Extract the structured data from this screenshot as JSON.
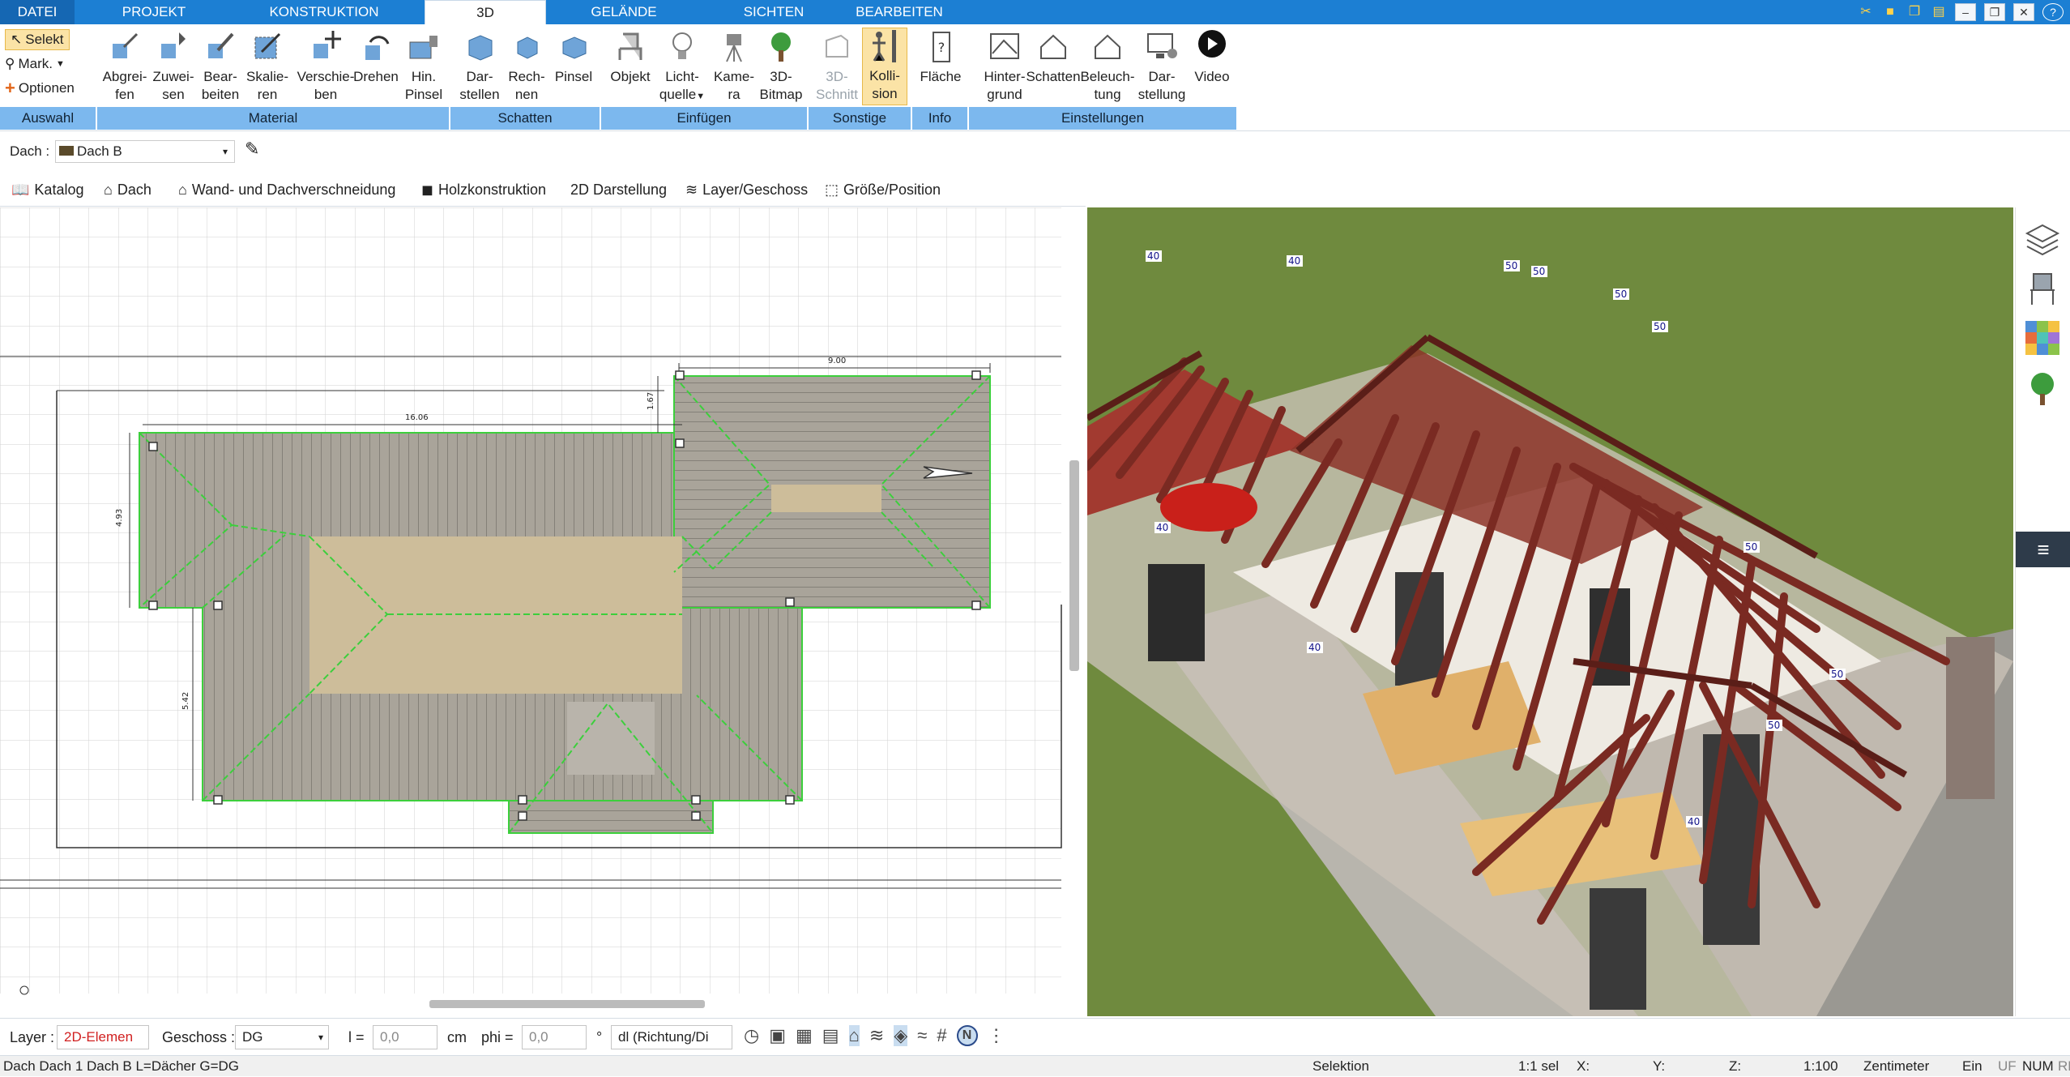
{
  "menu": {
    "tabs": [
      "DATEI",
      "PROJEKT",
      "KONSTRUKTION",
      "3D",
      "GELÄNDE",
      "SICHTEN",
      "BEARBEITEN"
    ],
    "active": "3D"
  },
  "ribbon": {
    "auswahl": {
      "selekt": "Selekt",
      "mark": "Mark.",
      "optionen": "Optionen"
    },
    "buttons": {
      "abgreifen": [
        "Abgrei-",
        "fen"
      ],
      "zuweisen": [
        "Zuwei-",
        "sen"
      ],
      "bearbeiten": [
        "Bear-",
        "beiten"
      ],
      "skalieren": [
        "Skalie-",
        "ren"
      ],
      "verschieben": [
        "Verschie-",
        "ben"
      ],
      "drehen": [
        "Drehen",
        ""
      ],
      "hinpinsel": [
        "Hin.",
        "Pinsel"
      ],
      "darstellen": [
        "Dar-",
        "stellen"
      ],
      "rechnen": [
        "Rech-",
        "nen"
      ],
      "pinsel": [
        "Pinsel",
        ""
      ],
      "objekt": [
        "Objekt",
        ""
      ],
      "lichtquelle": [
        "Licht-",
        "quelle"
      ],
      "kamera": [
        "Kame-",
        "ra"
      ],
      "bitmap": [
        "3D-",
        "Bitmap"
      ],
      "schnitt": [
        "3D-",
        "Schnitt"
      ],
      "kollision": [
        "Kolli-",
        "sion"
      ],
      "flaeche": [
        "Fläche",
        ""
      ],
      "hintergrund": [
        "Hinter-",
        "grund"
      ],
      "schatten": [
        "Schatten",
        ""
      ],
      "beleuchtung": [
        "Beleuch-",
        "tung"
      ],
      "darstellung": [
        "Dar-",
        "stellung"
      ],
      "video": [
        "Video",
        ""
      ]
    },
    "groups": [
      "Auswahl",
      "Material",
      "Schatten",
      "Einfügen",
      "Sonstige",
      "Info",
      "Einstellungen"
    ]
  },
  "dach": {
    "label": "Dach :",
    "value": "Dach B"
  },
  "toolbar2": [
    "Katalog",
    "Dach",
    "Wand- und Dachverschneidung",
    "Holzkonstruktion",
    "2D Darstellung",
    "Layer/Geschoss",
    "Größe/Position"
  ],
  "plan": {
    "dims": {
      "top_width": "9.00",
      "ridge_width": "16.06",
      "left_height": "4.93",
      "lower_height": "5.42",
      "small": "1.67"
    }
  },
  "view3d": {
    "labels": [
      "40",
      "40",
      "50",
      "50",
      "50",
      "50",
      "50",
      "40",
      "40",
      "50",
      "50",
      "40"
    ]
  },
  "bottom": {
    "layer_label": "Layer :",
    "layer_value": "2D-Elemen",
    "geschoss_label": "Geschoss :",
    "geschoss_value": "DG",
    "l_label": "l =",
    "l_value": "0,0",
    "l_unit": "cm",
    "phi_label": "phi =",
    "phi_value": "0,0",
    "phi_unit": "°",
    "dl_value": "dl (Richtung/Di"
  },
  "status": {
    "left": "Dach Dach 1 Dach B L=Dächer G=DG",
    "mode": "Selektion",
    "sel": "1:1 sel",
    "x": "X:",
    "y": "Y:",
    "z": "Z:",
    "scale": "1:100",
    "unit": "Zentimeter",
    "ein": "Ein",
    "uf": "UF",
    "num": "NUM",
    "rf": "RF"
  },
  "colors": {
    "accent": "#1c7fd3",
    "group_band": "#7cb8ee",
    "roof_green": "#3ccf3c",
    "rafter": "#7a2a22",
    "grass": "#6f8a3e"
  }
}
